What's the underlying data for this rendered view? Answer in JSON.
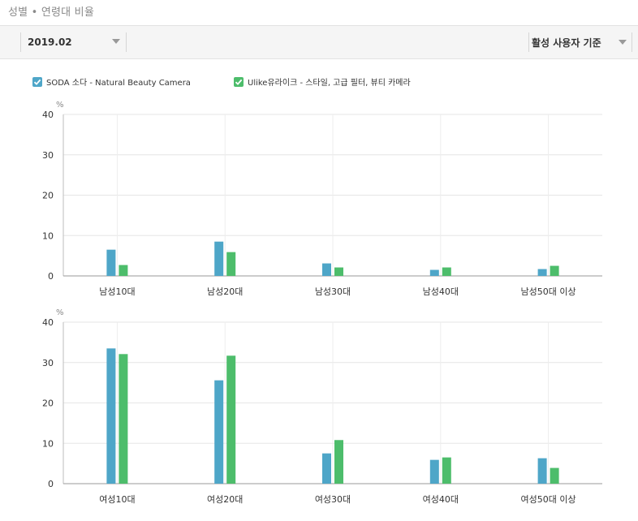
{
  "section_title": "성별 • 연령대 비율",
  "toolbar": {
    "date_value": "2019.02",
    "metric_value": "활성 사용자 기준"
  },
  "icons": {
    "date_caret": "chevron-down-icon",
    "metric_caret": "chevron-down-icon",
    "legend_check": "checkmark-icon"
  },
  "legend": [
    {
      "label": "SODA 소다 - Natural Beauty Camera",
      "color": "#4ea6c8",
      "checked": true
    },
    {
      "label": "Ulike유라이크 - 스타일, 고급 필터, 뷰티 카메라",
      "color": "#4dbd6b",
      "checked": true
    }
  ],
  "chart_data": [
    {
      "type": "bar",
      "unit_label": "%",
      "categories": [
        "남성10대",
        "남성20대",
        "남성30대",
        "남성40대",
        "남성50대 이상"
      ],
      "ylim": [
        0,
        40
      ],
      "yticks": [
        0,
        10,
        20,
        30,
        40
      ],
      "grid": true,
      "legend_position": "top-left",
      "series": [
        {
          "name": "SODA 소다 - Natural Beauty Camera",
          "color": "#4ea6c8",
          "values": [
            6.5,
            8.5,
            3.1,
            1.5,
            1.7
          ]
        },
        {
          "name": "Ulike유라이크 - 스타일, 고급 필터, 뷰티 카메라",
          "color": "#4dbd6b",
          "values": [
            2.7,
            5.9,
            2.1,
            2.1,
            2.5
          ]
        }
      ]
    },
    {
      "type": "bar",
      "unit_label": "%",
      "categories": [
        "여성10대",
        "여성20대",
        "여성30대",
        "여성40대",
        "여성50대 이상"
      ],
      "ylim": [
        0,
        40
      ],
      "yticks": [
        0,
        10,
        20,
        30,
        40
      ],
      "grid": true,
      "series": [
        {
          "name": "SODA 소다 - Natural Beauty Camera",
          "color": "#4ea6c8",
          "values": [
            33.5,
            25.6,
            7.5,
            5.9,
            6.3
          ]
        },
        {
          "name": "Ulike유라이크 - 스타일, 고급 필터, 뷰티 카메라",
          "color": "#4dbd6b",
          "values": [
            32.1,
            31.7,
            10.8,
            6.5,
            3.9
          ]
        }
      ]
    }
  ]
}
